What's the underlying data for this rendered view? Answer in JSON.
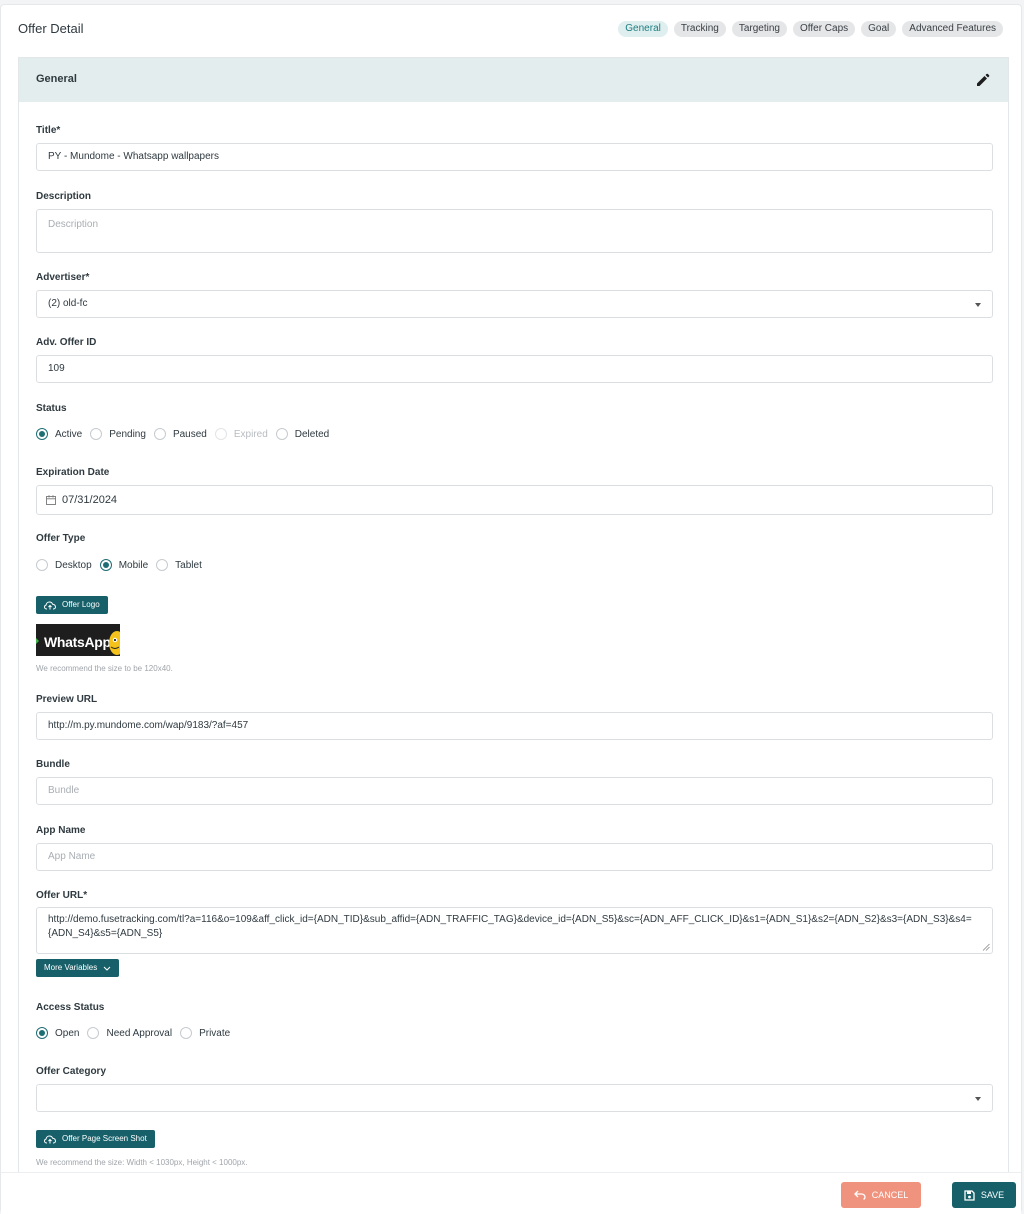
{
  "header": {
    "title": "Offer Detail",
    "tabs": [
      {
        "label": "General",
        "active": true
      },
      {
        "label": "Tracking"
      },
      {
        "label": "Targeting"
      },
      {
        "label": "Offer Caps"
      },
      {
        "label": "Goal"
      },
      {
        "label": "Advanced Features"
      }
    ]
  },
  "section": {
    "title": "General",
    "edit_icon": "pencil-icon"
  },
  "form": {
    "title": {
      "label": "Title*",
      "value": "PY - Mundome - Whatsapp wallpapers"
    },
    "description": {
      "label": "Description",
      "placeholder": "Description"
    },
    "advertiser": {
      "label": "Advertiser*",
      "value": "(2) old-fc"
    },
    "adv_offer_id": {
      "label": "Adv. Offer ID",
      "value": "109"
    },
    "status": {
      "label": "Status",
      "options": [
        "Active",
        "Pending",
        "Paused",
        "Expired",
        "Deleted"
      ],
      "selected": "Active",
      "disabled": [
        "Expired"
      ]
    },
    "expiration_date": {
      "label": "Expiration Date",
      "value": "07/31/2024",
      "icon": "calendar-icon"
    },
    "offer_type": {
      "label": "Offer Type",
      "options": [
        "Desktop",
        "Mobile",
        "Tablet"
      ],
      "selected": "Mobile"
    },
    "offer_logo": {
      "button_label": "Offer Logo",
      "button_icon": "cloud-upload-icon",
      "logo_text": "WhatsApp",
      "hint": "We recommend the size to be 120x40."
    },
    "preview_url": {
      "label": "Preview URL",
      "value": "http://m.py.mundome.com/wap/9183/?af=457"
    },
    "bundle": {
      "label": "Bundle",
      "placeholder": "Bundle"
    },
    "app_name": {
      "label": "App Name",
      "placeholder": "App Name"
    },
    "offer_url": {
      "label": "Offer URL*",
      "value": "http://demo.fusetracking.com/tl?a=116&o=109&aff_click_id={ADN_TID}&sub_affid={ADN_TRAFFIC_TAG}&device_id={ADN_S5}&sc={ADN_AFF_CLICK_ID}&s1={ADN_S1}&s2={ADN_S2}&s3={ADN_S3}&s4={ADN_S4}&s5={ADN_S5}",
      "more_variables_label": "More Variables",
      "more_icon": "chevron-down-icon"
    },
    "access_status": {
      "label": "Access Status",
      "options": [
        "Open",
        "Need Approval",
        "Private"
      ],
      "selected": "Open"
    },
    "offer_category": {
      "label": "Offer Category",
      "value": ""
    },
    "screenshot": {
      "button_label": "Offer Page Screen Shot",
      "button_icon": "cloud-upload-icon",
      "hint": "We recommend the size: Width < 1030px, Height < 1000px."
    }
  },
  "footer": {
    "cancel_label": "CANCEL",
    "cancel_icon": "undo-icon",
    "save_label": "SAVE",
    "save_icon": "save-icon"
  },
  "colors": {
    "accent": "#17606a",
    "cancel": "#f0937e",
    "section_header_bg": "#e3eded",
    "active_tab_bg": "#dfeeee"
  }
}
